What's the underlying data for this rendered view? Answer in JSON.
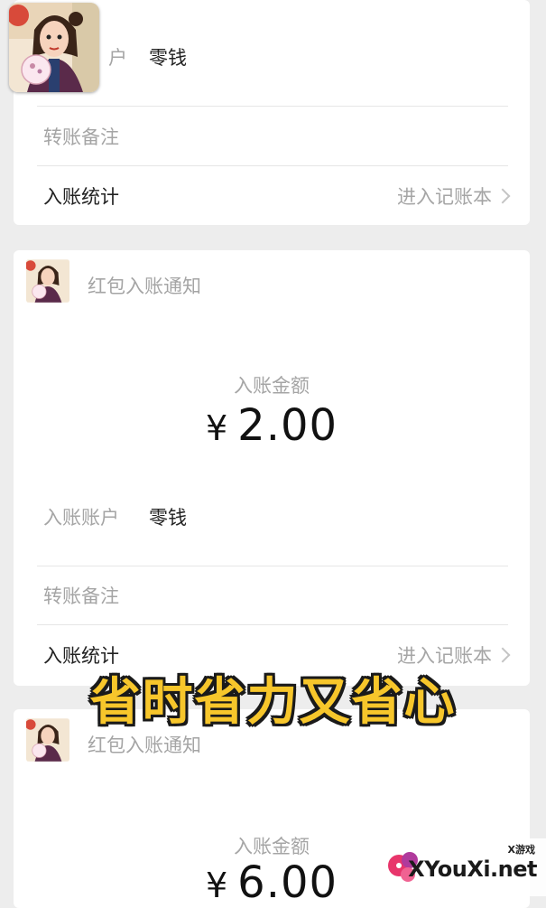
{
  "card1": {
    "account_label_partial": "户",
    "account_value": "零钱",
    "remark_label": "转账备注",
    "stats_label": "入账统计",
    "stats_link": "进入记账本"
  },
  "card2": {
    "title": "红包入账通知",
    "amount_label": "入账金额",
    "currency": "¥",
    "amount": "2.00",
    "account_label": "入账账户",
    "account_value": "零钱",
    "remark_label": "转账备注",
    "stats_label": "入账统计",
    "stats_link": "进入记账本"
  },
  "card3": {
    "title": "红包入账通知",
    "amount_label": "入账金额",
    "currency": "¥",
    "amount": "6.00"
  },
  "overlay": {
    "banner": "省时省力又省心"
  },
  "watermark": {
    "small": "X游戏",
    "site": "XYouXi.net"
  }
}
